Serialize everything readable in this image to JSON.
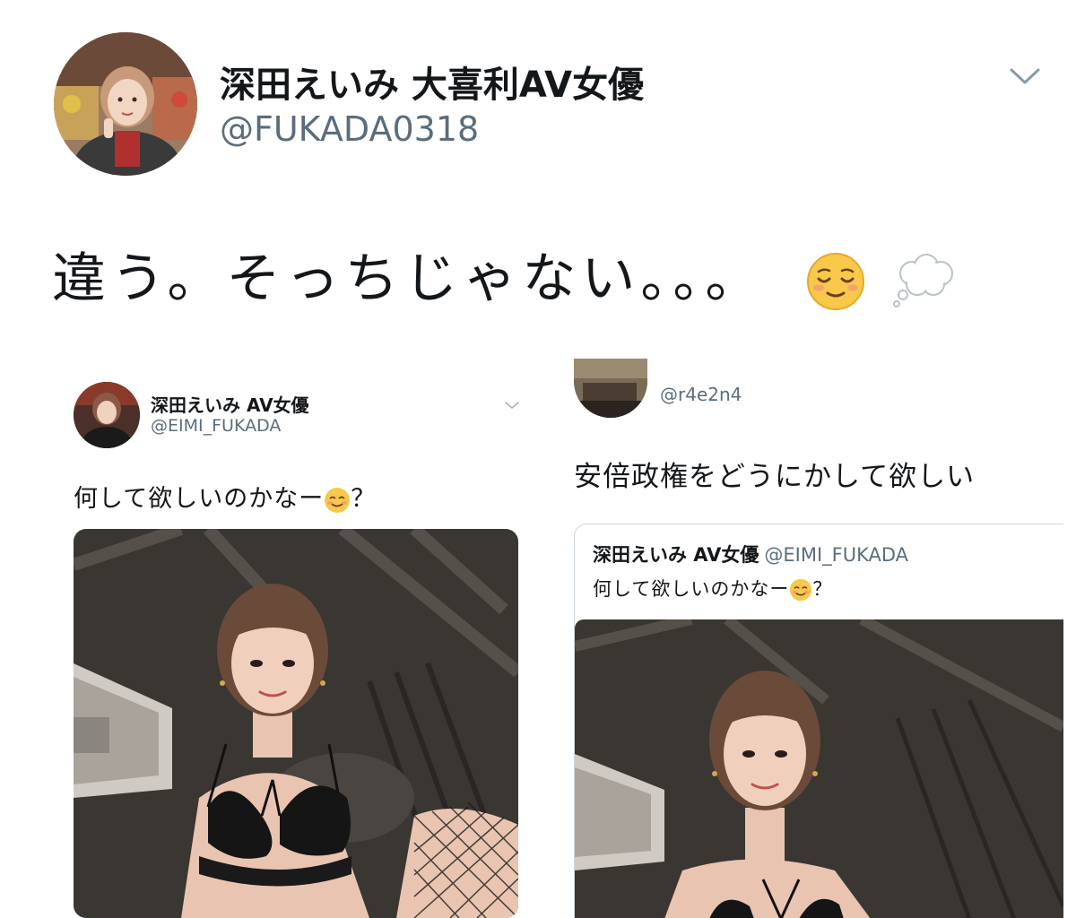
{
  "main_tweet": {
    "display_name": "深田えいみ 大喜利AV女優",
    "handle": "@FUKADA0318",
    "text": "違う。そっちじゃない。。。",
    "emojis": [
      "relieved-face",
      "thought-balloon"
    ],
    "menu_icon": "chevron-down-icon"
  },
  "left_screenshot": {
    "display_name": "深田えいみ AV女優",
    "handle": "@EIMI_FUKADA",
    "text_before_emoji": "何して欲しいのかなー",
    "text_after_emoji": "？",
    "emoji": "smiling-face",
    "menu_icon": "chevron-down-icon",
    "photo": "woman-in-black-lingerie-photo"
  },
  "right_screenshot": {
    "handle": "@r4e2n4",
    "text": "安倍政権をどうにかして欲しい",
    "quote": {
      "display_name": "深田えいみ AV女優",
      "handle": "@EIMI_FUKADA",
      "text_before_emoji": "何して欲しいのかなー",
      "text_after_emoji": "？",
      "emoji": "smiling-face",
      "photo": "woman-in-black-lingerie-photo"
    }
  },
  "colors": {
    "text_primary": "#14171a",
    "text_secondary": "#5b6d7c",
    "border": "#ccd6dd",
    "chevron": "#8899a6"
  }
}
